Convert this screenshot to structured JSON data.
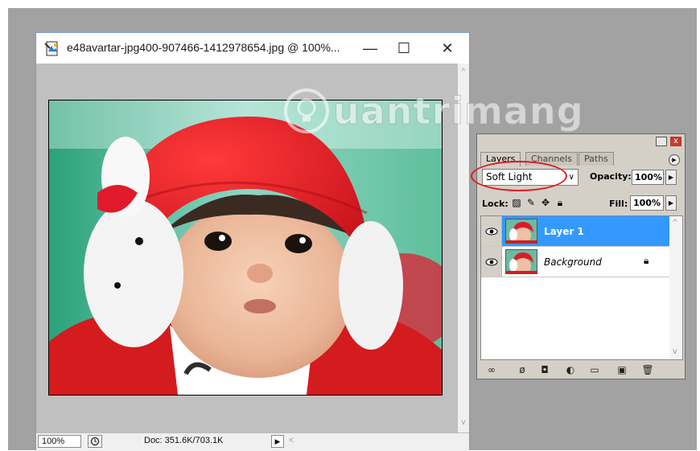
{
  "document": {
    "title": "e48avartar-jpg400-907466-1412978654.jpg @ 100%...",
    "minimize_symbol": "—",
    "maximize_symbol": "☐",
    "close_symbol": "✕",
    "zoom": "100%",
    "doc_info": "Doc: 351.6K/703.1K",
    "status_menu_symbol": "▶",
    "scroll_left_symbol": "<",
    "scroll_up_symbol": "^",
    "scroll_down_symbol": "v"
  },
  "watermark": {
    "text": "uantrimang"
  },
  "layers_palette": {
    "tabs": [
      {
        "label": "Layers"
      },
      {
        "label": "Channels"
      },
      {
        "label": "Paths"
      }
    ],
    "blend_mode": "Soft Light",
    "opacity_label": "Opacity:",
    "opacity_value": "100%",
    "lock_label": "Lock:",
    "fill_label": "Fill:",
    "fill_value": "100%",
    "layers": [
      {
        "name": "Layer 1",
        "selected": true
      },
      {
        "name": "Background",
        "selected": false,
        "locked": true
      }
    ],
    "highlight_color": "#e0191f",
    "selection_color": "#3399ff"
  },
  "icons": [
    "photoshop-doc-icon",
    "eye-icon",
    "link-icon",
    "fx-icon",
    "mask-icon",
    "adjustment-icon",
    "folder-icon",
    "new-layer-icon",
    "trash-icon",
    "lock-icon"
  ]
}
